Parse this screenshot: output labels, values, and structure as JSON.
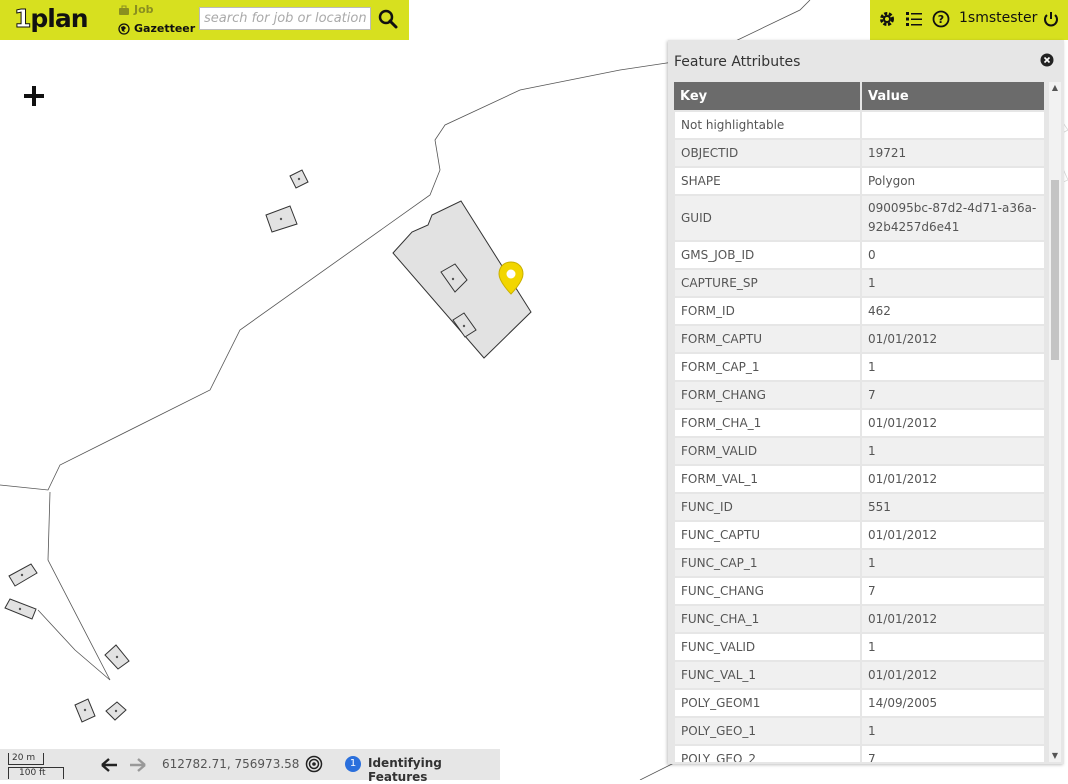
{
  "app": {
    "logo_one": "1",
    "logo_rest": "plan",
    "mode_job": "Job",
    "mode_gazetteer": "Gazetteer",
    "search_placeholder": "search for job or location"
  },
  "user": {
    "name": "1smstester"
  },
  "panel": {
    "title": "Feature Attributes",
    "columns": [
      "Key",
      "Value"
    ],
    "rows": [
      {
        "key": "Not highlightable",
        "value": ""
      },
      {
        "key": "OBJECTID",
        "value": "19721"
      },
      {
        "key": "SHAPE",
        "value": "Polygon"
      },
      {
        "key": "GUID",
        "value": "090095bc-87d2-4d71-a36a-92b4257d6e41"
      },
      {
        "key": "GMS_JOB_ID",
        "value": "0"
      },
      {
        "key": "CAPTURE_SP",
        "value": "1"
      },
      {
        "key": "FORM_ID",
        "value": "462"
      },
      {
        "key": "FORM_CAPTU",
        "value": "01/01/2012"
      },
      {
        "key": "FORM_CAP_1",
        "value": "1"
      },
      {
        "key": "FORM_CHANG",
        "value": "7"
      },
      {
        "key": "FORM_CHA_1",
        "value": "01/01/2012"
      },
      {
        "key": "FORM_VALID",
        "value": "1"
      },
      {
        "key": "FORM_VAL_1",
        "value": "01/01/2012"
      },
      {
        "key": "FUNC_ID",
        "value": "551"
      },
      {
        "key": "FUNC_CAPTU",
        "value": "01/01/2012"
      },
      {
        "key": "FUNC_CAP_1",
        "value": "1"
      },
      {
        "key": "FUNC_CHANG",
        "value": "7"
      },
      {
        "key": "FUNC_CHA_1",
        "value": "01/01/2012"
      },
      {
        "key": "FUNC_VALID",
        "value": "1"
      },
      {
        "key": "FUNC_VAL_1",
        "value": "01/01/2012"
      },
      {
        "key": "POLY_GEOM1",
        "value": "14/09/2005"
      },
      {
        "key": "POLY_GEO_1",
        "value": "1"
      },
      {
        "key": "POLY_GEO_2",
        "value": "7"
      }
    ]
  },
  "bottom": {
    "scale_m": "20 m",
    "scale_ft": "100 ft",
    "coords": "612782.71, 756973.58",
    "badge": "1",
    "status": "Identifying Features"
  },
  "colors": {
    "accent": "#d7e01f",
    "marker": "#f2d600",
    "badge": "#2a6fdc"
  }
}
